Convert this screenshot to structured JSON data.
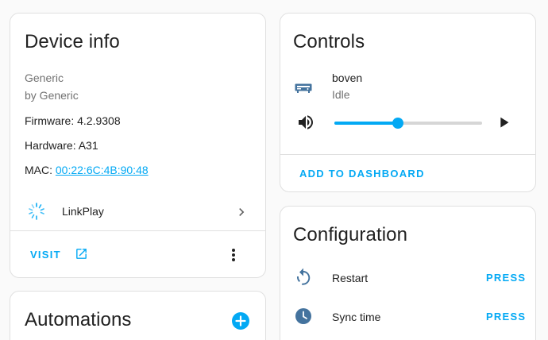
{
  "device_info": {
    "title": "Device info",
    "model": "Generic",
    "manufacturer": "by Generic",
    "firmware": "Firmware: 4.2.9308",
    "hardware": "Hardware: A31",
    "mac_label": "MAC: ",
    "mac_value": "00:22:6C:4B:90:48",
    "integration_name": "LinkPlay",
    "visit_label": "VISIT"
  },
  "automations": {
    "title": "Automations"
  },
  "controls": {
    "title": "Controls",
    "entity_name": "boven",
    "entity_state": "Idle",
    "volume_level": 0.43,
    "add_to_dashboard_label": "ADD TO DASHBOARD"
  },
  "configuration": {
    "title": "Configuration",
    "items": [
      {
        "label": "Restart",
        "action": "PRESS",
        "icon": "restart-icon"
      },
      {
        "label": "Sync time",
        "action": "PRESS",
        "icon": "clock-icon"
      }
    ]
  },
  "colors": {
    "accent": "#03a9f4",
    "icon_dark": "#44739e",
    "card_bg": "#ffffff",
    "page_bg": "#fafafa"
  }
}
